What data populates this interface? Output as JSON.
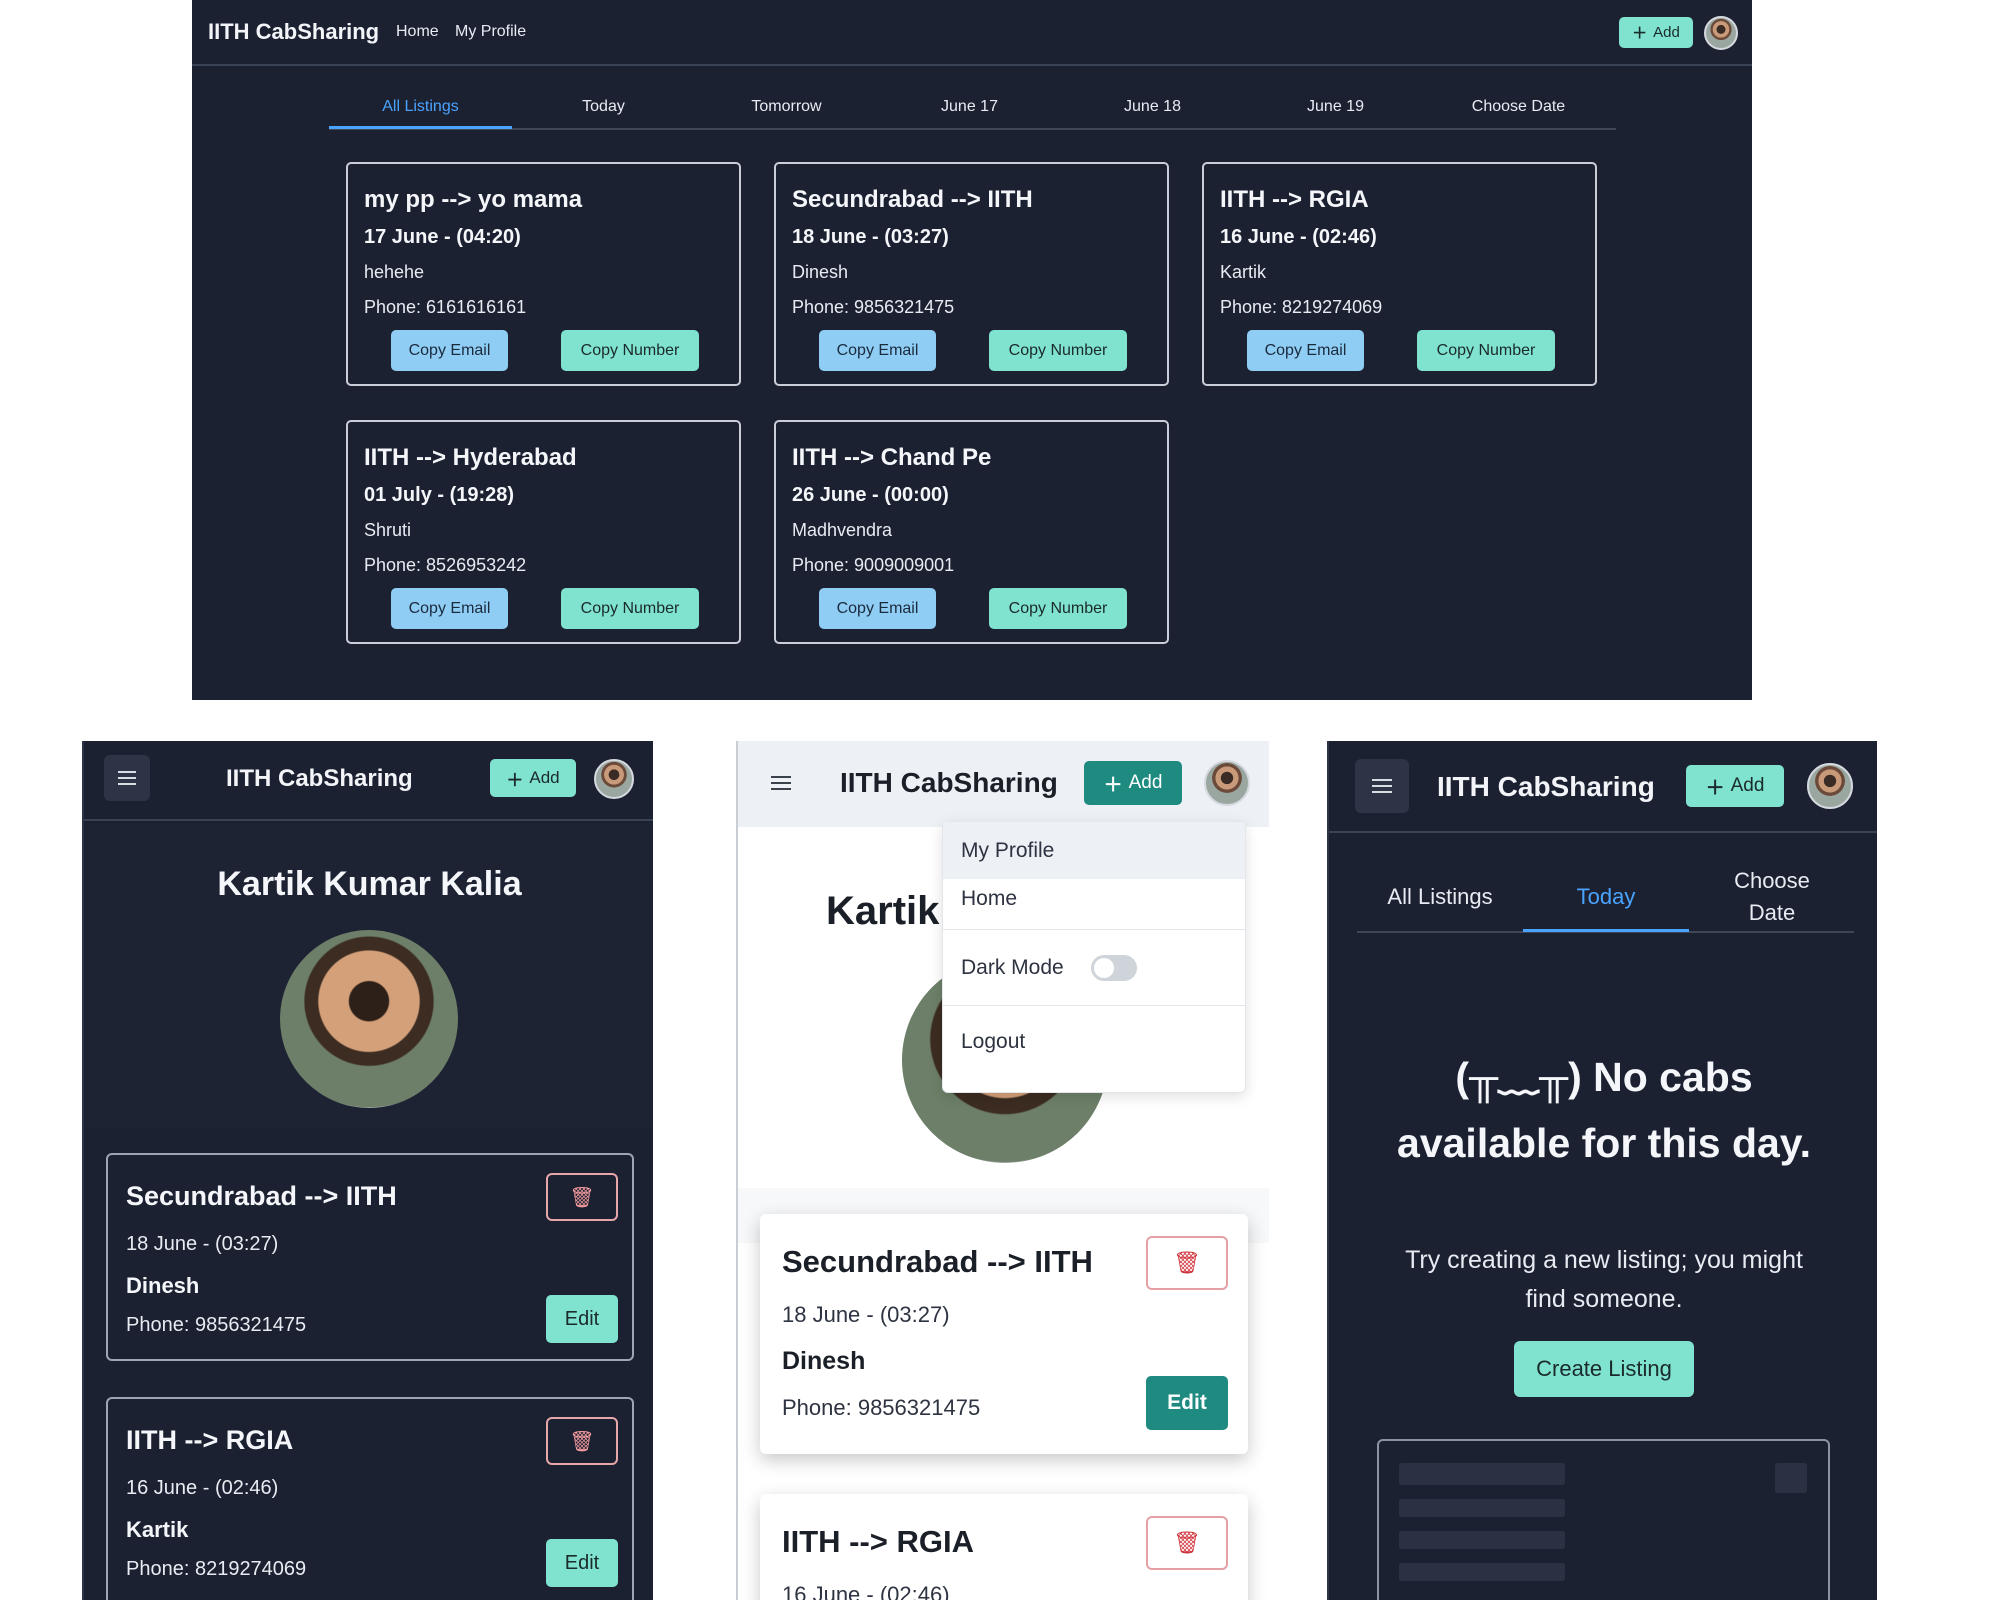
{
  "brand": "IITH CabSharing",
  "add_label": "Add",
  "desktop": {
    "nav_links": [
      "Home",
      "My Profile"
    ],
    "tabs": [
      "All Listings",
      "Today",
      "Tomorrow",
      "June 17",
      "June 18",
      "June 19",
      "Choose Date"
    ],
    "active_tab": "All Listings",
    "copy_email_label": "Copy Email",
    "copy_number_label": "Copy Number",
    "listings": [
      {
        "route": "my pp --> yo mama",
        "when": "17 June - (04:20)",
        "name": "hehehe",
        "phone": "Phone: 6161616161"
      },
      {
        "route": "Secundrabad --> IITH",
        "when": "18 June - (03:27)",
        "name": "Dinesh",
        "phone": "Phone: 9856321475"
      },
      {
        "route": "IITH --> RGIA",
        "when": "16 June - (02:46)",
        "name": "Kartik",
        "phone": "Phone: 8219274069"
      },
      {
        "route": "IITH --> Hyderabad",
        "when": "01 July - (19:28)",
        "name": "Shruti",
        "phone": "Phone: 8526953242"
      },
      {
        "route": "IITH --> Chand Pe",
        "when": "26 June - (00:00)",
        "name": "Madhvendra",
        "phone": "Phone: 9009009001"
      }
    ]
  },
  "profile_dark": {
    "user_name": "Kartik Kumar Kalia",
    "edit_label": "Edit",
    "listings": [
      {
        "route": "Secundrabad --> IITH",
        "when": "18 June - (03:27)",
        "name": "Dinesh",
        "phone": "Phone: 9856321475"
      },
      {
        "route": "IITH --> RGIA",
        "when": "16 June - (02:46)",
        "name": "Kartik",
        "phone": "Phone: 8219274069"
      }
    ]
  },
  "profile_light": {
    "user_name_partial": "Kartik",
    "menu": {
      "items": [
        "My Profile",
        "Home",
        "Dark Mode",
        "Logout"
      ],
      "dark_mode_on": false
    },
    "edit_label": "Edit",
    "listings": [
      {
        "route": "Secundrabad --> IITH",
        "when": "18 June - (03:27)",
        "name": "Dinesh",
        "phone": "Phone: 9856321475"
      },
      {
        "route": "IITH --> RGIA",
        "when": "16 June - (02:46)"
      }
    ]
  },
  "today_mobile": {
    "tabs": [
      "All Listings",
      "Today",
      "Choose Date"
    ],
    "active_tab": "Today",
    "empty_title": "(╥﹏╥) No cabs available for this day.",
    "empty_subtitle": "Try creating a new listing; you might find someone.",
    "create_label": "Create Listing"
  },
  "icons": {
    "add": "plus-icon",
    "menu": "hamburger-icon",
    "delete": "trash-icon",
    "avatar": "user-avatar"
  },
  "colors": {
    "dark_bg": "#1b2131",
    "accent_teal": "#7fe3d0",
    "accent_blue": "#90cdf4",
    "active_tab": "#4aa3ff",
    "edit_light": "#1e8a80",
    "delete_red": "#d0353d"
  }
}
